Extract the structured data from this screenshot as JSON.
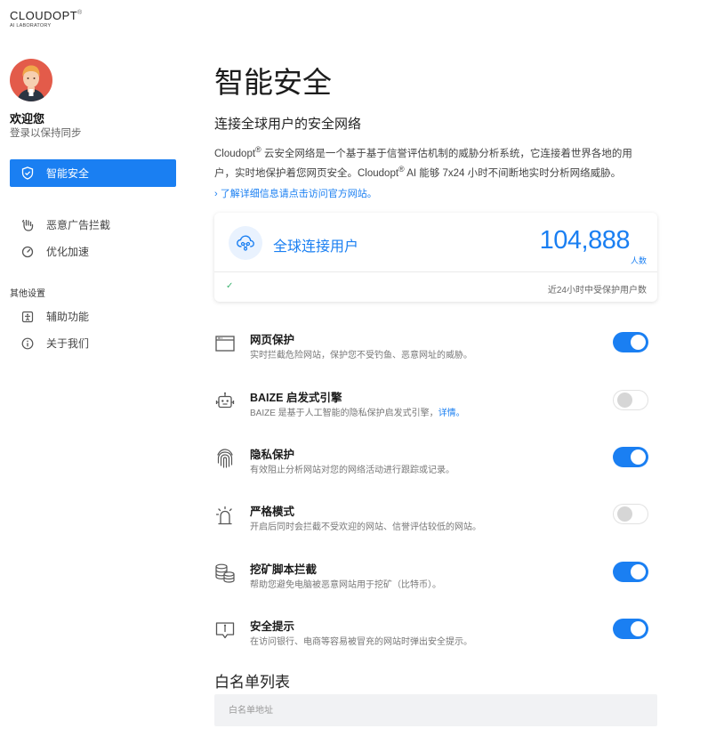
{
  "brand": {
    "name": "CLOUDOPT",
    "registered": "®",
    "tagline": "AI LABORATORY"
  },
  "user": {
    "welcome": "欢迎您",
    "login_hint": "登录以保持同步"
  },
  "sidebar": {
    "active_item": {
      "label": "智能安全",
      "icon": "shield-icon"
    },
    "items": [
      {
        "label": "恶意广告拦截",
        "icon": "hand-stop-icon"
      },
      {
        "label": "优化加速",
        "icon": "gauge-icon"
      }
    ],
    "other_section_label": "其他设置",
    "other_items": [
      {
        "label": "辅助功能",
        "icon": "accessibility-icon"
      },
      {
        "label": "关于我们",
        "icon": "info-icon"
      }
    ]
  },
  "main": {
    "title": "智能安全",
    "subtitle": "连接全球用户的安全网络",
    "desc": {
      "p1": "Cloudopt",
      "reg": "®",
      "p2": " 云安全网络是一个基于基于信誉评估机制的威胁分析系统，它连接着世界各地的用户，实时地保护着您网页安全。Cloudopt",
      "p3": " AI 能够 7x24 小时不间断地实时分析网络威胁。"
    },
    "more_link": "了解详细信息请点击访问官方网站。",
    "stats_card": {
      "label": "全球连接用户",
      "count": "104,888",
      "unit": "人数",
      "note": "近24小时中受保护用户数",
      "status_icon": "check-icon"
    },
    "features": [
      {
        "title": "网页保护",
        "desc": "实时拦截危险网站，保护您不受钓鱼、恶意网址的威胁。",
        "link": "",
        "enabled": true,
        "icon": "browser-window-icon"
      },
      {
        "title": "BAIZE 启发式引擎",
        "desc": "BAIZE 是基于人工智能的隐私保护启发式引擎，",
        "link": "详情。",
        "enabled": false,
        "icon": "robot-icon"
      },
      {
        "title": "隐私保护",
        "desc": "有效阻止分析网站对您的网络活动进行跟踪或记录。",
        "link": "",
        "enabled": true,
        "icon": "fingerprint-icon"
      },
      {
        "title": "严格模式",
        "desc": "开启后同时会拦截不受欢迎的网站、信誉评估较低的网站。",
        "link": "",
        "enabled": false,
        "icon": "siren-icon"
      },
      {
        "title": "挖矿脚本拦截",
        "desc": "帮助您避免电脑被恶意网站用于挖矿（比特币）。",
        "link": "",
        "enabled": true,
        "icon": "coins-icon"
      },
      {
        "title": "安全提示",
        "desc": "在访问银行、电商等容易被冒充的网站时弹出安全提示。",
        "link": "",
        "enabled": true,
        "icon": "alert-message-icon"
      }
    ],
    "whitelist": {
      "title": "白名单列表",
      "placeholder": "白名单地址"
    }
  },
  "colors": {
    "accent": "#1a7ff2",
    "avatar_bg": "#e35b4a",
    "success": "#3cb371"
  }
}
